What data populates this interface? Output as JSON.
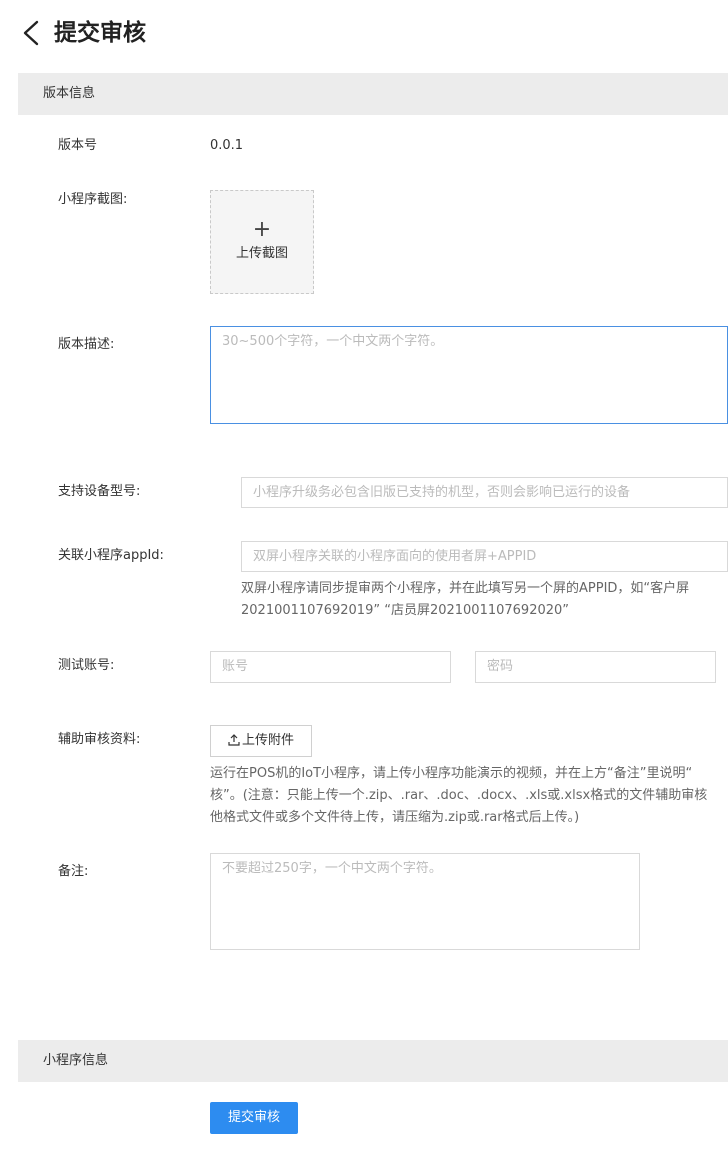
{
  "header": {
    "title": "提交审核"
  },
  "sections": {
    "version_info": "版本信息",
    "miniprogram_info": "小程序信息"
  },
  "form": {
    "version_label": "版本号",
    "version_value": "0.0.1",
    "screenshot_label": "小程序截图:",
    "upload_screenshot_label": "上传截图",
    "description_label": "版本描述:",
    "description_placeholder": "30~500个字符，一个中文两个字符。",
    "device_label": "支持设备型号:",
    "device_placeholder": "小程序升级务必包含旧版已支持的机型，否则会影响已运行的设备",
    "appid_label": "关联小程序appId:",
    "appid_placeholder": "双屏小程序关联的小程序面向的使用者屏+APPID",
    "appid_hint_line1": "双屏小程序请同步提审两个小程序，并在此填写另一个屏的APPID，如“客户屏",
    "appid_hint_line2": "2021001107692019” “店员屏2021001107692020”",
    "test_account_label": "测试账号:",
    "account_placeholder": "账号",
    "password_placeholder": "密码",
    "aux_label": "辅助审核资料:",
    "attach_button": "上传附件",
    "aux_hint_line1": "运行在POS机的IoT小程序，请上传小程序功能演示的视频，并在上方“备注”里说明“",
    "aux_hint_line2": "核”。(注意：只能上传一个.zip、.rar、.doc、.docx、.xls或.xlsx格式的文件辅助审核",
    "aux_hint_line3": "他格式文件或多个文件待上传，请压缩为.zip或.rar格式后上传。)",
    "remark_label": "备注:",
    "remark_placeholder": "不要超过250字，一个中文两个字符。"
  },
  "actions": {
    "submit": "提交审核"
  },
  "icons": {
    "back": "chevron-left-icon",
    "plus": "plus-icon",
    "upload": "upload-icon"
  },
  "colors": {
    "primary": "#2d8cf0",
    "section_bg": "#ececec",
    "focus_border": "#4a90e2"
  }
}
